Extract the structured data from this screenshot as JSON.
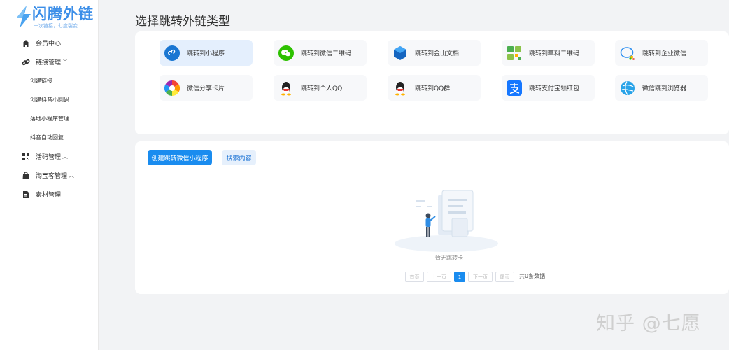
{
  "logo": {
    "title": "闪腾外链",
    "subtitle": "一次链接，七度裂变"
  },
  "sidebar": {
    "items": [
      {
        "label": "会员中心",
        "icon": "home-icon"
      },
      {
        "label": "链接管理",
        "icon": "link-icon",
        "caret": "﹀"
      },
      {
        "label": "创建链接"
      },
      {
        "label": "创建抖音小圆码"
      },
      {
        "label": "落地小程序管理"
      },
      {
        "label": "抖音自动回复"
      },
      {
        "label": "活码管理",
        "icon": "qrcode-icon",
        "caret": "︿"
      },
      {
        "label": "淘宝客管理",
        "icon": "shopping-bag-icon",
        "caret": "︿"
      },
      {
        "label": "素材管理",
        "icon": "document-icon"
      }
    ]
  },
  "main": {
    "title": "选择跳转外链类型",
    "types": [
      {
        "label": "跳转到小程序",
        "icon": "mini-program-icon"
      },
      {
        "label": "跳转到微信二维码",
        "icon": "wechat-icon"
      },
      {
        "label": "跳转到金山文档",
        "icon": "kingsoft-docs-icon"
      },
      {
        "label": "跳转到草料二维码",
        "icon": "caoliao-qrcode-icon"
      },
      {
        "label": "跳转到企业微信",
        "icon": "wecom-icon"
      },
      {
        "label": "微信分享卡片",
        "icon": "share-card-icon"
      },
      {
        "label": "跳转到个人QQ",
        "icon": "qq-icon"
      },
      {
        "label": "跳转到QQ群",
        "icon": "qq-group-icon"
      },
      {
        "label": "跳转支付宝领红包",
        "icon": "alipay-icon"
      },
      {
        "label": "微信跳到浏览器",
        "icon": "browser-icon"
      }
    ],
    "create_button": "创建跳转微信小程序",
    "search_button": "搜索内容",
    "empty_text": "暂无跳转卡",
    "pagination": {
      "first": "首页",
      "prev": "上一页",
      "current": "1",
      "next": "下一页",
      "last": "尾页",
      "total": "共0条数据"
    }
  },
  "watermark": "知乎 @七愿",
  "colors": {
    "primary": "#1a8cef",
    "logo": "#3b8ee8",
    "active_card": "#e4effd"
  }
}
